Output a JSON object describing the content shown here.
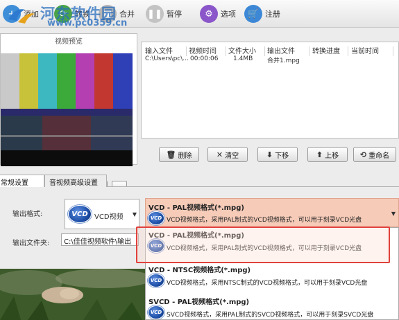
{
  "toolbar": {
    "buttons": [
      {
        "label": "添加",
        "icon": "add-icon"
      },
      {
        "label": "转换",
        "icon": "convert-icon"
      },
      {
        "label": "合并",
        "icon": "merge-icon"
      },
      {
        "label": "暂停",
        "icon": "pause-icon"
      },
      {
        "label": "选项",
        "icon": "options-gear-icon"
      },
      {
        "label": "注册",
        "icon": "register-cart-icon"
      }
    ]
  },
  "watermark": {
    "title": "河东软件园",
    "url": "www.pc0359.cn"
  },
  "preview": {
    "title": "视频预览",
    "controls": [
      "play-icon",
      "pause-icon",
      "stop-icon",
      "headphones-icon",
      "snapshot-icon",
      "folder-icon"
    ]
  },
  "file_table": {
    "columns": [
      "输入文件",
      "视频时间",
      "文件大小",
      "输出文件",
      "转换进度",
      "当前时间"
    ],
    "rows": [
      {
        "input": "C:\\Users\\pc\\...",
        "duration": "00:00:06",
        "size": "1.4MB",
        "output": "合并1.mpg",
        "progress": "",
        "current": ""
      }
    ]
  },
  "list_actions": {
    "delete": "删除",
    "clear": "清空",
    "down": "下移",
    "up": "上移",
    "rename": "重命名"
  },
  "tabs": [
    {
      "label": "常规设置",
      "active": true
    },
    {
      "label": "音视频高级设置",
      "active": false
    }
  ],
  "settings": {
    "format_label": "输出格式:",
    "format_value": "VCD视频",
    "format_logo": "VCD",
    "dir_label": "输出文件夹:",
    "dir_value": "C:\\佳佳视频软件\\输出"
  },
  "dropdown": {
    "selected": {
      "title": "VCD - PAL视频格式(*.mpg)",
      "desc": "VCD视频格式，采用PAL制式的VCD视频格式，可以用于刻录VCD光盘"
    },
    "options": [
      {
        "title": "VCD - PAL视频格式(*.mpg)",
        "desc": "VCD视频格式，采用PAL制式的VCD视频格式，可以用于刻录VCD光盘",
        "logo": "VCD"
      },
      {
        "title": "VCD - NTSC视频格式(*.mpg)",
        "desc": "VCD视频格式，采用NTSC制式的VCD视频格式，可以用于刻录VCD光盘",
        "logo": "VCD"
      },
      {
        "title": "SVCD - PAL视频格式(*.mpg)",
        "desc": "SVCD视频格式，采用PAL制式的SVCD视频格式，可以用于刻录SVCD光盘",
        "logo": "VCD"
      }
    ]
  },
  "colors": {
    "selected_bg": "#f6cbb8",
    "highlight_border": "#e0413c",
    "watermark": "#286ebe"
  }
}
